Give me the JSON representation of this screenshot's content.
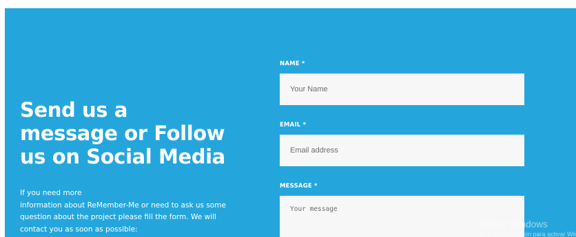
{
  "section": {
    "heading": [
      "Send us a",
      "message or Follow",
      "us on Social Media"
    ],
    "intro_lines": [
      "If you need more",
      "information about ReMember-Me or need to ask us some",
      "question about the project please fill the form. We will",
      "contact you as soon as possible:"
    ],
    "background_color": "#24a6dd"
  },
  "form": {
    "name": {
      "label": "NAME *",
      "placeholder": "Your Name",
      "value": ""
    },
    "email": {
      "label": "EMAIL *",
      "placeholder": "Email address",
      "value": ""
    },
    "message": {
      "label": "MESSAGE *",
      "placeholder": "Your message",
      "value": ""
    }
  },
  "watermark": {
    "title": "Activar Windows",
    "subtitle": "Ve a Configuración para activar Windows."
  }
}
